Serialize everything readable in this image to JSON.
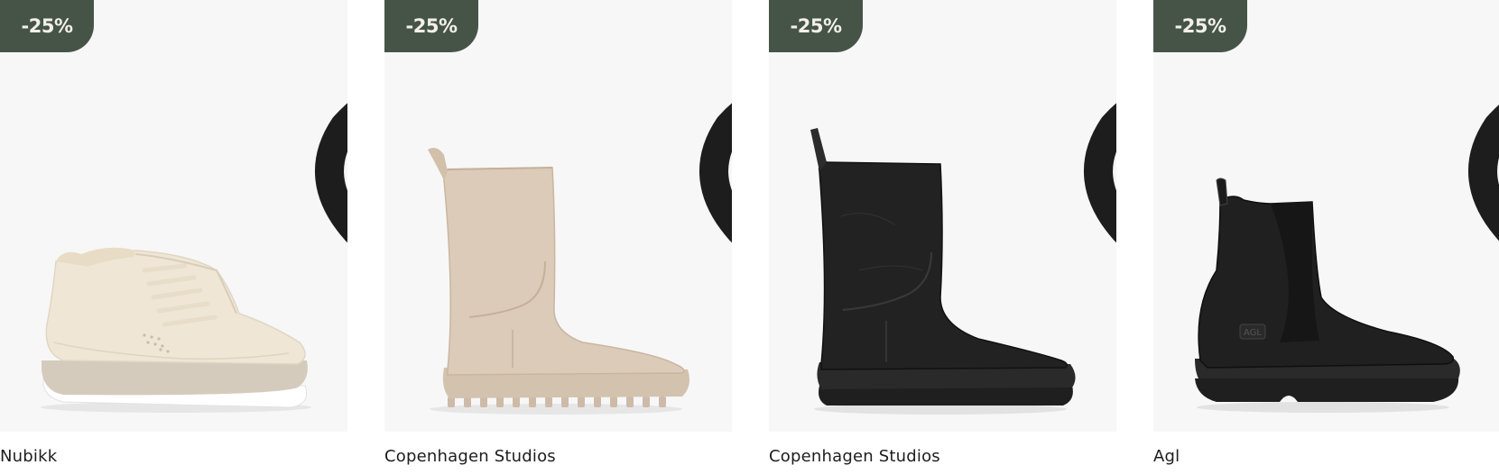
{
  "products": [
    {
      "brand": "Nubikk",
      "discount": "-25%",
      "wishlist_icon": "heart-icon",
      "image": "cream-high-top-sneaker"
    },
    {
      "brand": "Copenhagen Studios",
      "discount": "-25%",
      "wishlist_icon": "heart-icon",
      "image": "beige-mid-calf-boot"
    },
    {
      "brand": "Copenhagen Studios",
      "discount": "-25%",
      "wishlist_icon": "heart-icon",
      "image": "black-mid-calf-boot"
    },
    {
      "brand": "Agl",
      "discount": "-25%",
      "wishlist_icon": "heart-icon",
      "image": "black-chelsea-boot"
    }
  ],
  "colors": {
    "badge_bg": "#465448",
    "badge_text": "#f2f0ea",
    "image_bg": "#f7f7f7"
  }
}
